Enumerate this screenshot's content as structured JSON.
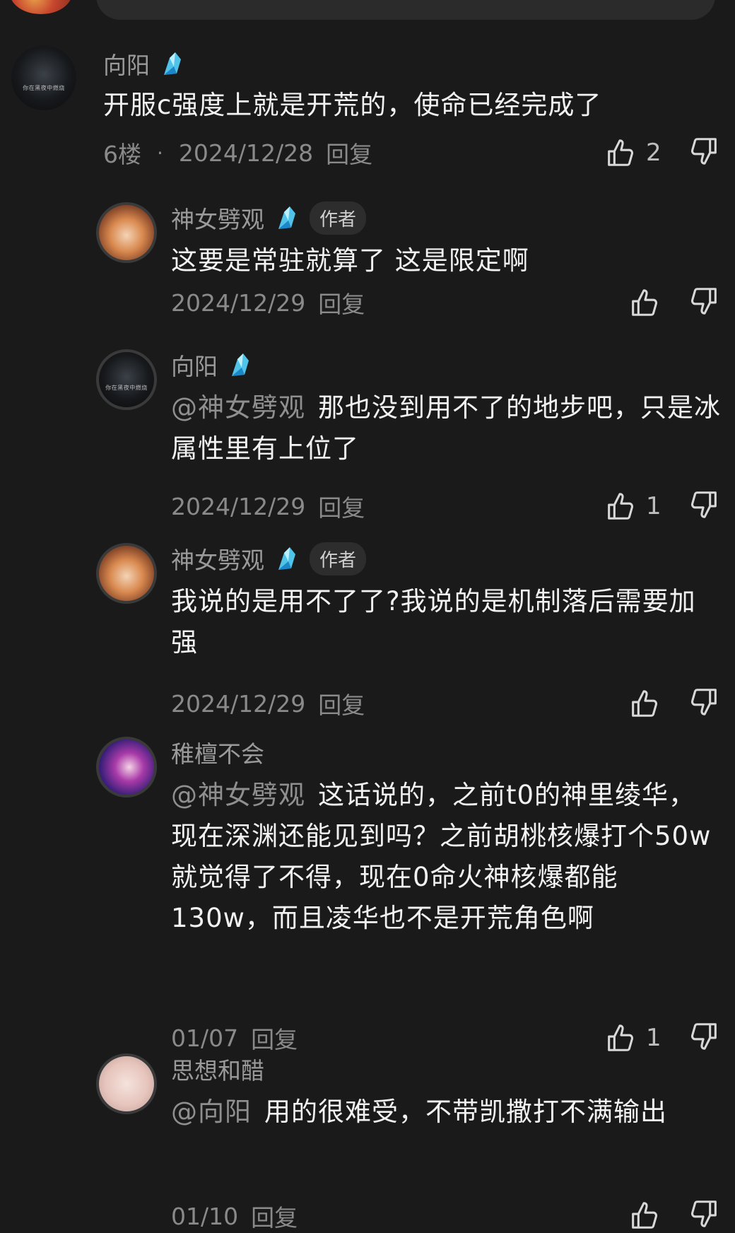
{
  "comments": [
    {
      "name": "向阳",
      "badge_icon": "blue-crystal-badge-icon",
      "avatar_caption": "你在黑夜中燃烧",
      "text": "开服c强度上就是开荒的，使命已经完成了",
      "floor": "6楼",
      "separator": "·",
      "date": "2024/12/28",
      "reply_label": "回复",
      "likes": "2"
    }
  ],
  "replies": [
    {
      "name": "神女劈观",
      "badge_icon": "blue-crystal-badge-icon",
      "author_tag": "作者",
      "text": "这要是常驻就算了 这是限定啊",
      "date": "2024/12/29",
      "reply_label": "回复",
      "likes": ""
    },
    {
      "name": "向阳",
      "badge_icon": "blue-crystal-badge-icon",
      "avatar_caption": "你在黑夜中燃烧",
      "mention": "@神女劈观",
      "text": "那也没到用不了的地步吧，只是冰属性里有上位了",
      "date": "2024/12/29",
      "reply_label": "回复",
      "likes": "1"
    },
    {
      "name": "神女劈观",
      "badge_icon": "blue-crystal-badge-icon",
      "author_tag": "作者",
      "text": "我说的是用不了了?我说的是机制落后需要加强",
      "date": "2024/12/29",
      "reply_label": "回复",
      "likes": ""
    },
    {
      "name": "稚檀不会",
      "mention": "@神女劈观",
      "text": "这话说的，之前t0的神里绫华，现在深渊还能见到吗？之前胡桃核爆打个50w就觉得了不得，现在0命火神核爆都能130w，而且凌华也不是开荒角色啊",
      "date": "01/07",
      "reply_label": "回复",
      "likes": "1"
    },
    {
      "name": "思想和醋",
      "mention": "@向阳",
      "text": "用的很难受，不带凯撒打不满输出",
      "date": "01/10",
      "reply_label": "回复",
      "likes": ""
    }
  ],
  "icons": {
    "like": "thumbs-up-icon",
    "dislike": "thumbs-down-icon"
  },
  "colors": {
    "background": "#1a1a1a",
    "name": "#9a9a9a",
    "text": "#f2f2f2",
    "badge": "#4fc3e8"
  }
}
